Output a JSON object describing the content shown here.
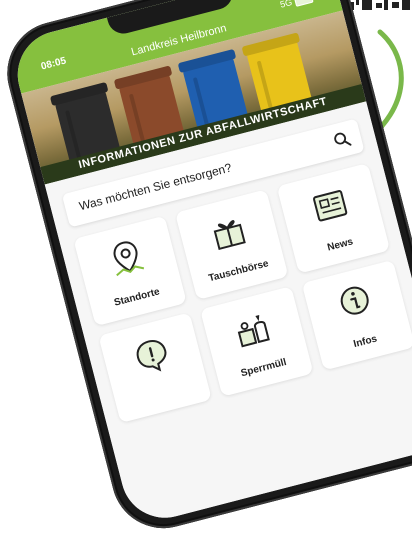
{
  "status": {
    "time": "08:05",
    "network": "5G"
  },
  "app": {
    "title": "Landkreis Heilbronn"
  },
  "banner": {
    "text": "INFORMATIONEN ZUR ABFALLWIRTSCHAFT"
  },
  "search": {
    "placeholder": "Was möchten Sie entsorgen?",
    "icon": "search-icon"
  },
  "tiles": [
    {
      "label": "Standorte",
      "icon": "location-pin-icon"
    },
    {
      "label": "Tauschbörse",
      "icon": "gift-box-icon"
    },
    {
      "label": "News",
      "icon": "news-icon"
    },
    {
      "label": "",
      "icon": "alert-bubble-icon"
    },
    {
      "label": "Sperrmüll",
      "icon": "bulky-waste-icon"
    },
    {
      "label": "Infos",
      "icon": "info-icon"
    }
  ],
  "colors": {
    "brand_green": "#86c03e",
    "banner_dark": "#2a3a1a",
    "arrow_green": "#7ab84a"
  }
}
